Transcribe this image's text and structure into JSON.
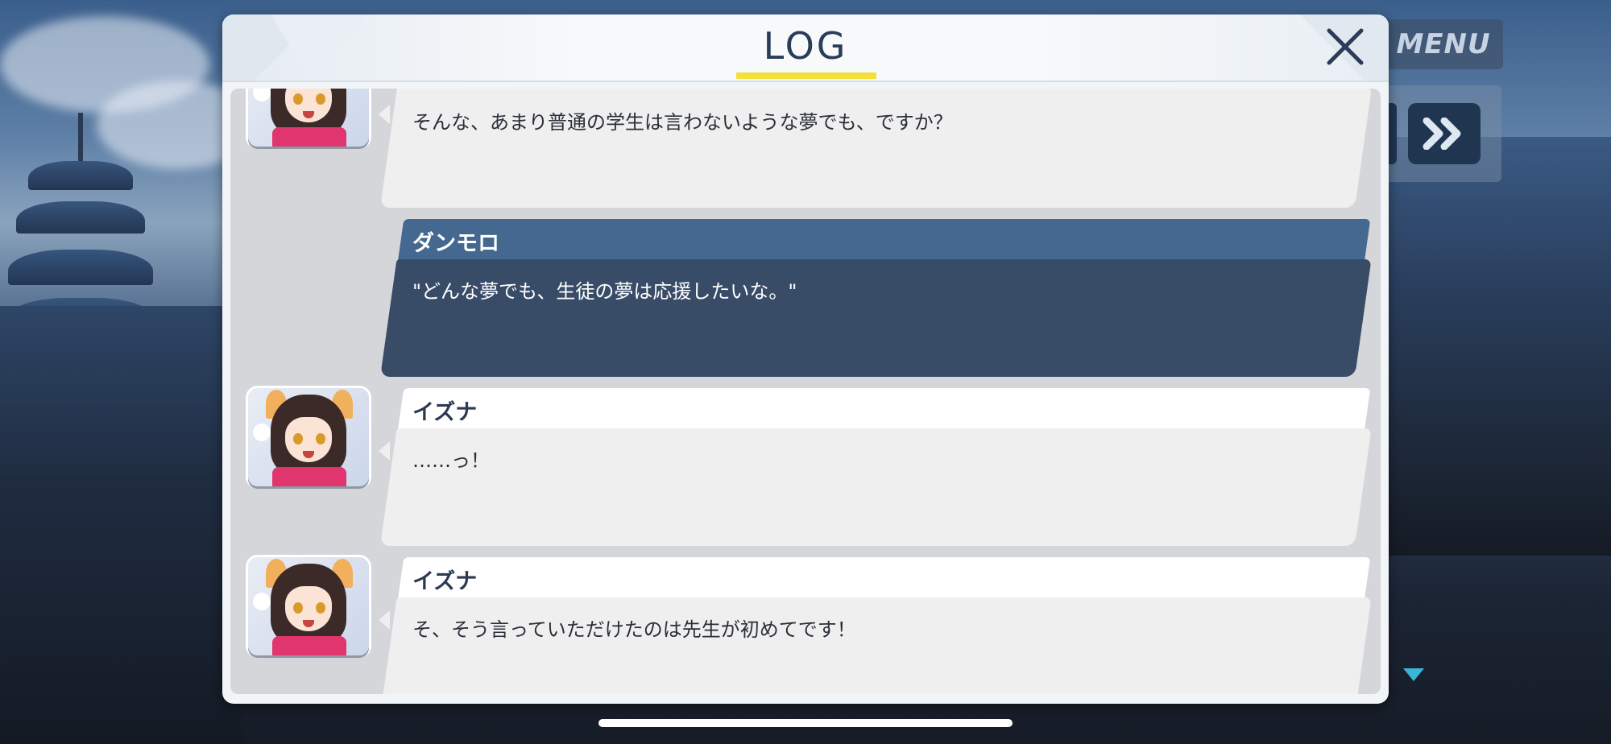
{
  "dialog": {
    "title": "LOG"
  },
  "side_menu": {
    "menu_label": "MENU"
  },
  "entries": [
    {
      "speaker": "",
      "text": "そんな、あまり普通の学生は言わないような夢でも、ですか？",
      "type": "npc"
    },
    {
      "speaker": "ダンモロ",
      "text": "\"どんな夢でも、生徒の夢は応援したいな。\"",
      "type": "player"
    },
    {
      "speaker": "イズナ",
      "text": "……っ！",
      "type": "npc"
    },
    {
      "speaker": "イズナ",
      "text": "そ、そう言っていただけたのは先生が初めてです！",
      "type": "npc"
    }
  ],
  "colors": {
    "accent_underline": "#f4e03b",
    "player_bubble": "#384c67",
    "player_name": "#44688f",
    "scroll_arrow": "#3ab5d8"
  },
  "icons": [
    "close-icon",
    "fast-forward-icon",
    "scroll-down-icon",
    "character-portrait"
  ]
}
